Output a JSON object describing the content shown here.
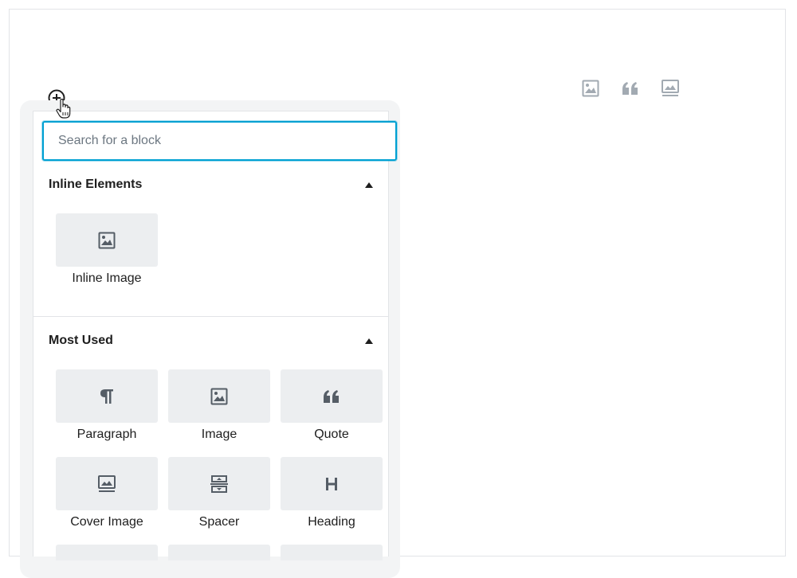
{
  "inserter": {
    "search_placeholder": "Search for a block"
  },
  "inline_toolbar": {
    "buttons": [
      {
        "icon": "image-icon"
      },
      {
        "icon": "quote-icon"
      },
      {
        "icon": "cover-image-icon"
      }
    ]
  },
  "sections": {
    "inline": {
      "title": "Inline Elements",
      "items": [
        {
          "label": "Inline Image",
          "icon": "image-icon"
        }
      ]
    },
    "most_used": {
      "title": "Most Used",
      "items": [
        {
          "label": "Paragraph",
          "icon": "paragraph-icon"
        },
        {
          "label": "Image",
          "icon": "image-icon"
        },
        {
          "label": "Quote",
          "icon": "quote-icon"
        },
        {
          "label": "Cover Image",
          "icon": "cover-image-icon"
        },
        {
          "label": "Spacer",
          "icon": "spacer-icon"
        },
        {
          "label": "Heading",
          "icon": "heading-icon"
        }
      ]
    }
  },
  "colors": {
    "focus": "#00a0d2",
    "tile": "#eceef0",
    "icon": "#555d66",
    "muted_icon": "#a2aab2"
  }
}
